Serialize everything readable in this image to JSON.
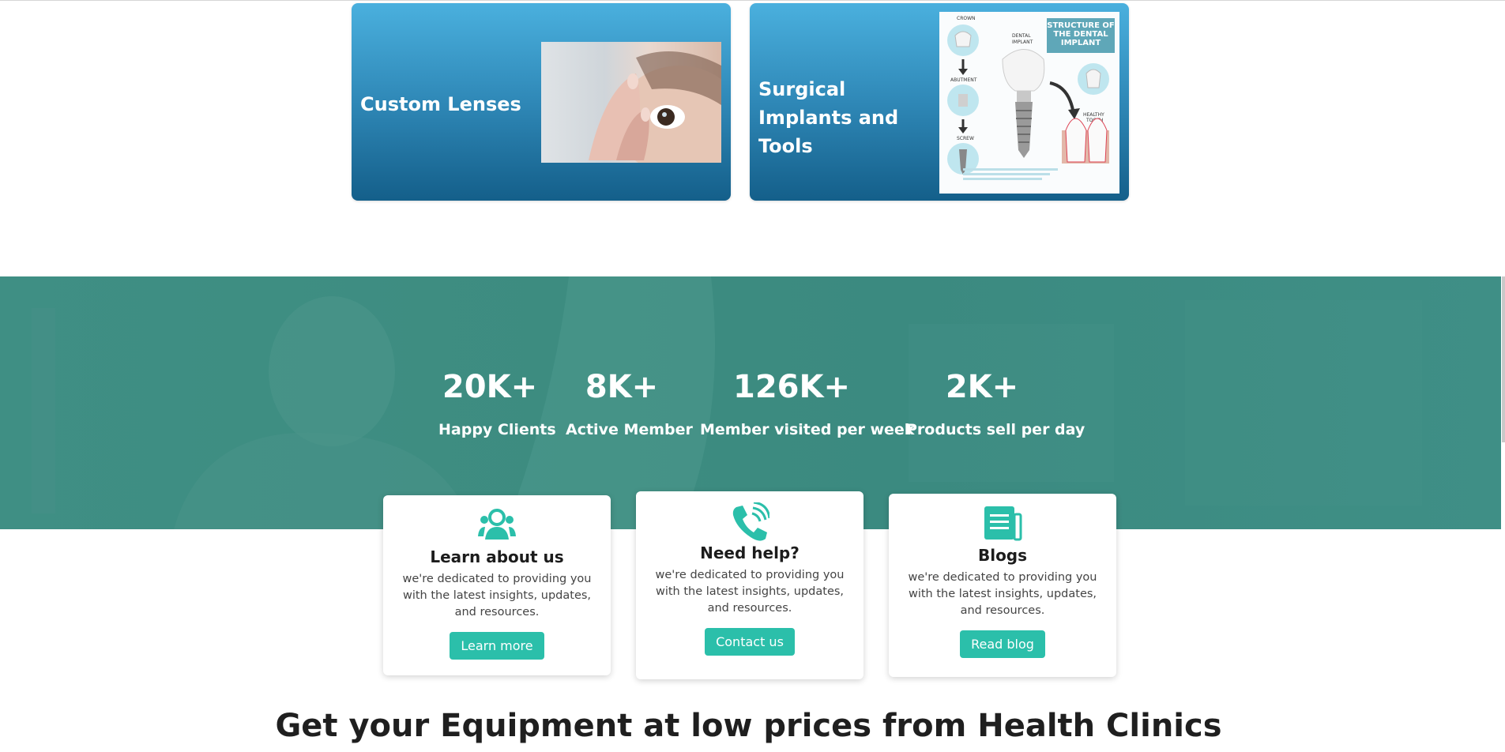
{
  "categories": [
    {
      "title": "Custom Lenses"
    },
    {
      "title": "Surgical Implants and Tools",
      "poster_title": "STRUCTURE OF THE DENTAL IMPLANT",
      "poster_labels": [
        "CROWN",
        "ABUTMENT",
        "SCREW",
        "DENTAL IMPLANT",
        "HEALTHY TOOTH"
      ]
    }
  ],
  "stats": [
    {
      "value": "20K+",
      "label": "Happy Clients"
    },
    {
      "value": "8K+",
      "label": "Active Member"
    },
    {
      "value": "126K+",
      "label": "Member visited per week"
    },
    {
      "value": "2K+",
      "label": "Products sell per day"
    }
  ],
  "info_cards": [
    {
      "icon": "users-icon",
      "title": "Learn about us",
      "description": "we're dedicated to providing you with the latest insights, updates, and resources.",
      "button": "Learn more"
    },
    {
      "icon": "phone-icon",
      "title": "Need help?",
      "description": "we're dedicated to providing you with the latest insights, updates, and resources.",
      "button": "Contact us"
    },
    {
      "icon": "newspaper-icon",
      "title": "Blogs",
      "description": "we're dedicated to providing you with the latest insights, updates, and resources.",
      "button": "Read blog"
    }
  ],
  "bottom_heading": "Get your Equipment at low prices from Health Clinics",
  "colors": {
    "accent": "#2bbfaa",
    "band": "#3d8c80",
    "card_blue": "#2f88b7"
  }
}
